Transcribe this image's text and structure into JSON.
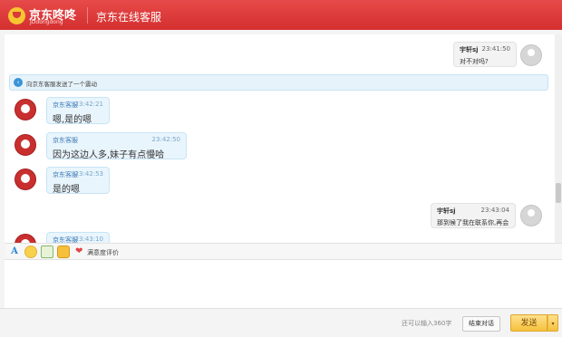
{
  "header": {
    "logo_name": "京东咚咚",
    "logo_sub": "JDdongdong",
    "title": "京东在线客服"
  },
  "notice": {
    "text": "向京东客服发送了一个震动"
  },
  "messages": [
    {
      "from": "user",
      "name": "宇轩sj",
      "time": "23:41:50",
      "text": "对不对吗?"
    },
    {
      "from": "agent",
      "name": "京东客服",
      "time": "23:42:21",
      "text": "嗯,是的嗯"
    },
    {
      "from": "agent",
      "name": "京东客服",
      "time": "23:42:50",
      "text": "因为这边人多,妹子有点慢哈"
    },
    {
      "from": "agent",
      "name": "京东客服",
      "time": "23:42:53",
      "text": "是的嗯"
    },
    {
      "from": "user",
      "name": "宇轩sj",
      "time": "23:43:04",
      "text": "那到候了我在联系你,再会"
    },
    {
      "from": "agent",
      "name": "京东客服",
      "time": "23:43:10",
      "text": ""
    }
  ],
  "toolbar": {
    "font_icon": "font-icon",
    "emoji_icon": "emoji-icon",
    "image_icon": "image-icon",
    "shake_icon": "shake-icon",
    "heart_icon": "heart-icon",
    "rate_label": "满意度评价",
    "font_glyph": "A",
    "heart_glyph": "❤"
  },
  "footer": {
    "remaining": "还可以输入360字",
    "end_label": "结束对话",
    "send_label": "发送",
    "send_arrow": "▾"
  },
  "colors": {
    "brand": "#d83b3b",
    "accent": "#f6c23c",
    "bubble_agent": "#e9f5fd"
  }
}
